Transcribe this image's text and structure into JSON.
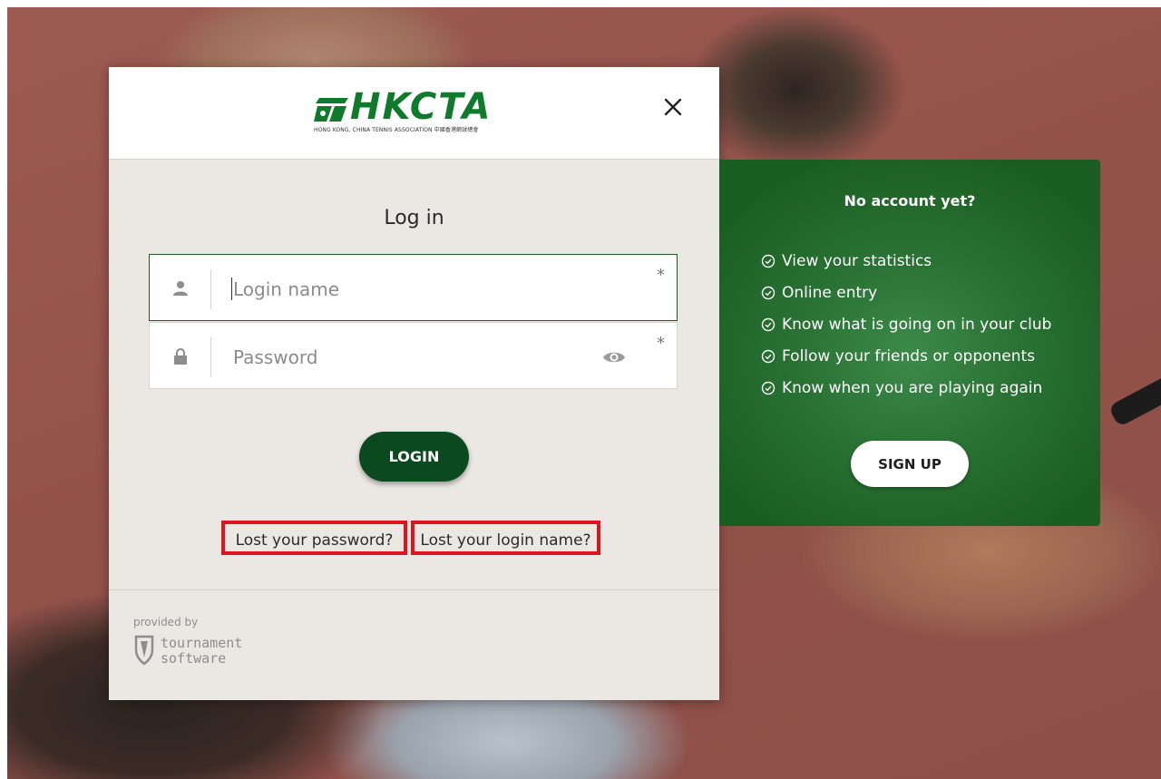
{
  "brand": {
    "logo_text": "HKCTA",
    "logo_subtext": "HONG KONG, CHINA TENNIS ASSOCIATION 中國香港網球總會"
  },
  "close_symbol": "✕",
  "login": {
    "title": "Log in",
    "login_name_placeholder": "Login name",
    "password_placeholder": "Password",
    "required_mark": "*",
    "submit_label": "LOGIN",
    "lost_password": "Lost your password?",
    "lost_login_name": "Lost your login name?"
  },
  "footer": {
    "provided_by": "provided by",
    "vendor_line1": "tournament",
    "vendor_line2": "software"
  },
  "signup": {
    "title": "No account yet?",
    "benefits": [
      "View your statistics",
      "Online entry",
      "Know what is going on in your club",
      "Follow your friends or opponents",
      "Know when you are playing again"
    ],
    "button_label": "SIGN UP"
  },
  "colors": {
    "brand_green": "#0e7a2a",
    "button_dark_green": "#0b4a1e",
    "highlight_red": "#e0141e"
  },
  "icons": {
    "user": "user-icon",
    "lock": "lock-icon",
    "eye": "eye-icon",
    "check": "check-circle-icon",
    "close": "close-icon",
    "shield": "shield-icon"
  }
}
